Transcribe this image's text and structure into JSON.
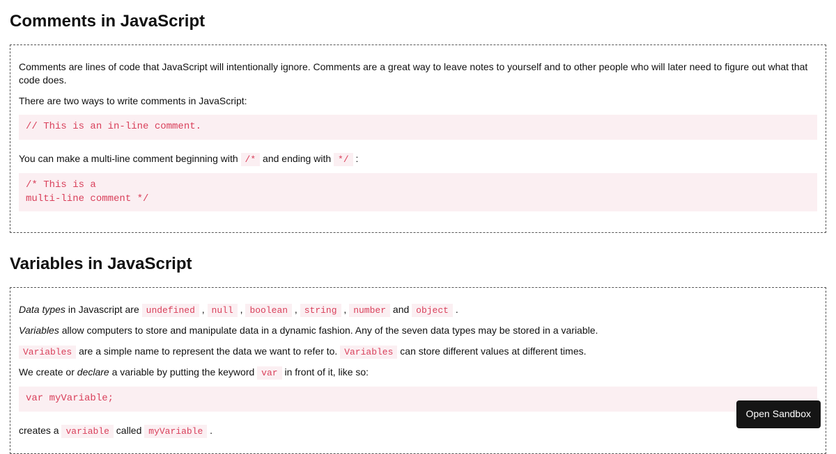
{
  "sections": [
    {
      "heading": "Comments in JavaScript",
      "p1": "Comments are lines of code that JavaScript will intentionally ignore. Comments are a great way to leave notes to yourself and to other people who will later need to figure out what that code does.",
      "p2": "There are two ways to write comments in JavaScript:",
      "code1": "// This is an in-line comment.",
      "p3a": "You can make a multi-line comment beginning with ",
      "p3_code1": "/*",
      "p3b": " and ending with ",
      "p3_code2": "*/",
      "p3c": " :",
      "code2": "/* This is a\nmulti-line comment */"
    },
    {
      "heading": "Variables in JavaScript",
      "p1_em": "Data types",
      "p1a": " in Javascript are ",
      "types": [
        "undefined",
        "null",
        "boolean",
        "string",
        "number"
      ],
      "p1_and": " and ",
      "type_last": "object",
      "p1_end": " .",
      "p2_em": "Variables",
      "p2": " allow computers to store and manipulate data in a dynamic fashion. Any of the seven data types may be stored in a variable.",
      "p3_code1": "Variables",
      "p3a": " are a simple name to represent the data we want to refer to. ",
      "p3_code2": "Variables",
      "p3b": " can store different values at different times.",
      "p4a": "We create or ",
      "p4_em": "declare",
      "p4b": " a variable by putting the keyword ",
      "p4_code": "var",
      "p4c": " in front of it, like so:",
      "code1": "var myVariable;",
      "p5a": "creates a ",
      "p5_code1": "variable",
      "p5b": " called ",
      "p5_code2": "myVariable",
      "p5c": " ."
    }
  ],
  "button": {
    "open_sandbox": "Open Sandbox"
  }
}
